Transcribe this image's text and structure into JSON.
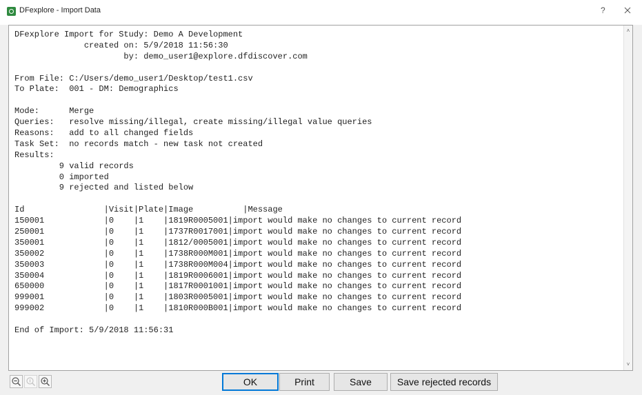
{
  "window": {
    "title": "DFexplore - Import Data",
    "help_label": "?"
  },
  "report": {
    "lines": [
      "DFexplore Import for Study: Demo A Development",
      "              created on: 5/9/2018 11:56:30",
      "                      by: demo_user1@explore.dfdiscover.com",
      "",
      "From File: C:/Users/demo_user1/Desktop/test1.csv",
      "To Plate:  001 - DM: Demographics",
      "",
      "Mode:      Merge",
      "Queries:   resolve missing/illegal, create missing/illegal value queries",
      "Reasons:   add to all changed fields",
      "Task Set:  no records match - new task not created",
      "Results:",
      "         9 valid records",
      "         0 imported",
      "         9 rejected and listed below",
      "",
      "Id                |Visit|Plate|Image          |Message",
      "150001            |0    |1    |1819R0005001|import would make no changes to current record",
      "250001            |0    |1    |1737R0017001|import would make no changes to current record",
      "350001            |0    |1    |1812/0005001|import would make no changes to current record",
      "350002            |0    |1    |1738R000M001|import would make no changes to current record",
      "350003            |0    |1    |1738R000M004|import would make no changes to current record",
      "350004            |0    |1    |1819R0006001|import would make no changes to current record",
      "650000            |0    |1    |1817R0001001|import would make no changes to current record",
      "999001            |0    |1    |1803R0005001|import would make no changes to current record",
      "999002            |0    |1    |1810R000B001|import would make no changes to current record",
      "",
      "End of Import: 5/9/2018 11:56:31"
    ]
  },
  "buttons": {
    "ok": "OK",
    "print": "Print",
    "save": "Save",
    "save_rejected": "Save rejected records"
  },
  "zoom": {
    "out_icon": "zoom-out-icon",
    "reset_icon": "zoom-reset-icon",
    "in_icon": "zoom-in-icon"
  },
  "colors": {
    "default_button_border": "#0078d7",
    "app_icon": "#2f8a3f"
  }
}
